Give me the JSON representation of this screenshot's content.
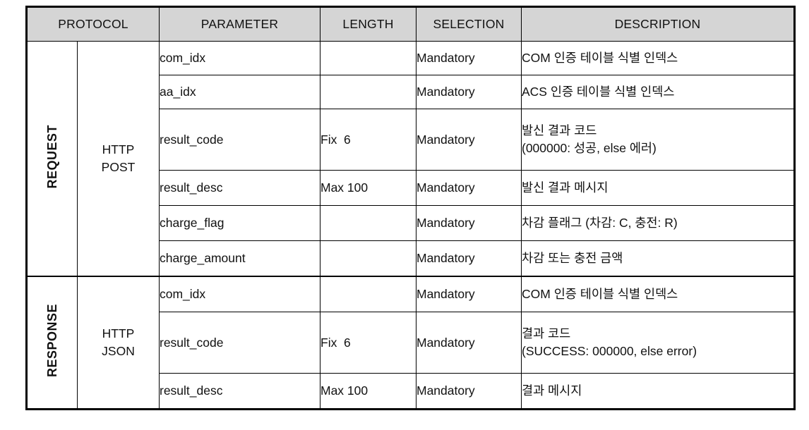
{
  "table": {
    "headers": [
      {
        "label": "PROTOCOL",
        "span": 2
      },
      {
        "label": "PARAMETER",
        "span": 1
      },
      {
        "label": "LENGTH",
        "span": 1
      },
      {
        "label": "SELECTION",
        "span": 1
      },
      {
        "label": "DESCRIPTION",
        "span": 1
      }
    ],
    "sections": [
      {
        "protocol": "REQUEST",
        "method_lines": [
          "HTTP",
          "POST"
        ],
        "rows": [
          {
            "parameter": "com_idx",
            "length": "",
            "selection": "Mandatory",
            "description_lines": [
              "COM 인증 테이블 식별 인덱스"
            ]
          },
          {
            "parameter": "aa_idx",
            "length": "",
            "selection": "Mandatory",
            "description_lines": [
              "ACS 인증 테이블 식별 인덱스"
            ]
          },
          {
            "parameter": "result_code",
            "length": "Fix  6",
            "selection": "Mandatory",
            "description_lines": [
              "발신 결과 코드",
              "(000000: 성공, else 에러)"
            ]
          },
          {
            "parameter": "result_desc",
            "length": "Max 100",
            "selection": "Mandatory",
            "description_lines": [
              "발신 결과 메시지"
            ]
          },
          {
            "parameter": "charge_flag",
            "length": "",
            "selection": "Mandatory",
            "description_lines": [
              "차감 플래그 (차감: C, 충전: R)"
            ]
          },
          {
            "parameter": "charge_amount",
            "length": "",
            "selection": "Mandatory",
            "description_lines": [
              "차감 또는 충전 금액"
            ]
          }
        ]
      },
      {
        "protocol": "RESPONSE",
        "method_lines": [
          "HTTP",
          "JSON"
        ],
        "rows": [
          {
            "parameter": "com_idx",
            "length": "",
            "selection": "Mandatory",
            "description_lines": [
              "COM 인증 테이블 식별 인덱스"
            ]
          },
          {
            "parameter": "result_code",
            "length": "Fix  6",
            "selection": "Mandatory",
            "description_lines": [
              "결과 코드",
              "(SUCCESS: 000000, else error)"
            ]
          },
          {
            "parameter": "result_desc",
            "length": "Max 100",
            "selection": "Mandatory",
            "description_lines": [
              "결과 메시지"
            ]
          }
        ]
      }
    ]
  },
  "colors": {
    "header_background": "#d5d5d5",
    "border": "#000000",
    "text": "#111111",
    "page_background": "#ffffff"
  }
}
